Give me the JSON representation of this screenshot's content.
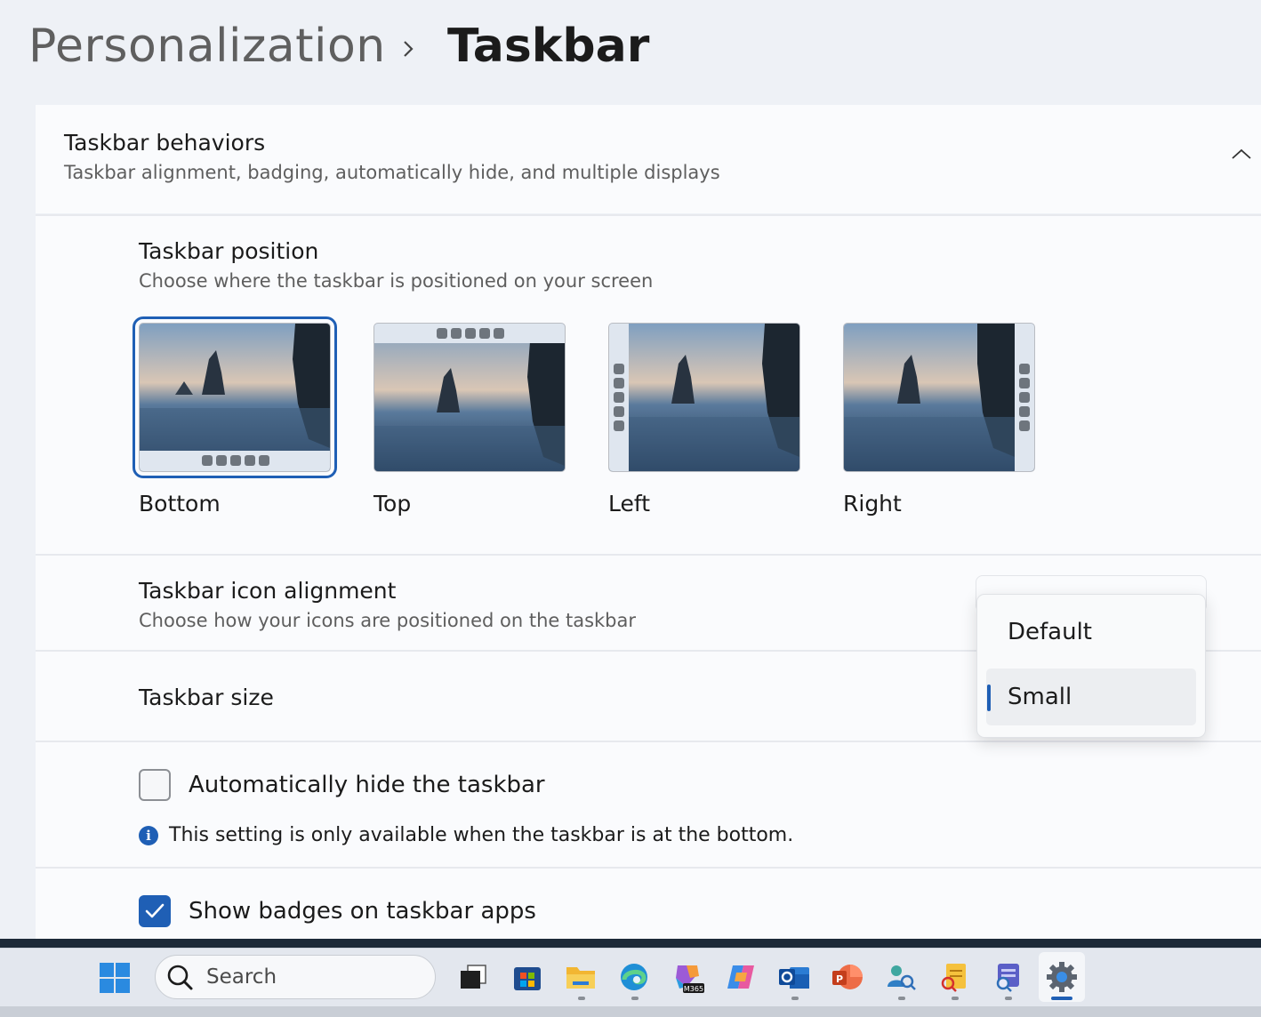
{
  "breadcrumb": {
    "parent": "Personalization",
    "current": "Taskbar"
  },
  "behaviors": {
    "title": "Taskbar behaviors",
    "subtitle": "Taskbar alignment, badging, automatically hide, and multiple displays",
    "expanded": true
  },
  "position": {
    "title": "Taskbar position",
    "subtitle": "Choose where the taskbar is positioned on your screen",
    "options": [
      {
        "label": "Bottom",
        "selected": true
      },
      {
        "label": "Top",
        "selected": false
      },
      {
        "label": "Left",
        "selected": false
      },
      {
        "label": "Right",
        "selected": false
      }
    ]
  },
  "alignment": {
    "title": "Taskbar icon alignment",
    "subtitle": "Choose how your icons are positioned on the taskbar"
  },
  "size": {
    "title": "Taskbar size",
    "menu": {
      "options": [
        "Default",
        "Small"
      ],
      "selected": "Small"
    }
  },
  "autohide": {
    "label": "Automatically hide the taskbar",
    "checked": false,
    "info": "This setting is only available when the taskbar is at the bottom."
  },
  "badges": {
    "label": "Show badges on taskbar apps",
    "checked": true
  },
  "taskbar": {
    "search_placeholder": "Search",
    "apps": [
      "start-icon",
      "task-view-icon",
      "microsoft-store-icon",
      "file-explorer-icon",
      "edge-icon",
      "microsoft-365-icon",
      "copilot-icon",
      "outlook-icon",
      "powerpoint-icon",
      "people-search-icon",
      "notes-search-icon",
      "teams-search-icon",
      "settings-icon"
    ],
    "m365_badge": "M365"
  },
  "colors": {
    "accent": "#1f5fb5",
    "background": "#eef1f6",
    "panel": "#fafbfd"
  }
}
